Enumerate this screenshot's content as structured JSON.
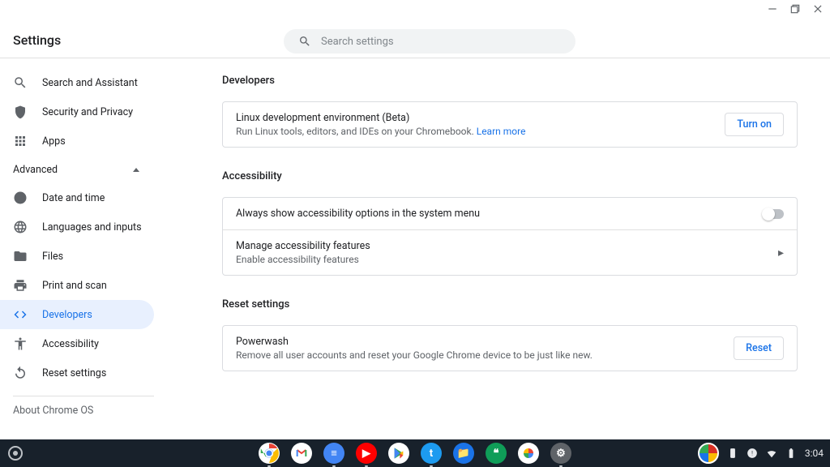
{
  "window": {
    "title": "Settings"
  },
  "search": {
    "placeholder": "Search settings"
  },
  "sidebar": {
    "top": [
      {
        "id": "search-assistant",
        "label": "Search and Assistant"
      },
      {
        "id": "security-privacy",
        "label": "Security and Privacy"
      },
      {
        "id": "apps",
        "label": "Apps"
      }
    ],
    "advanced_label": "Advanced",
    "adv": [
      {
        "id": "date-time",
        "label": "Date and time"
      },
      {
        "id": "languages",
        "label": "Languages and inputs"
      },
      {
        "id": "files",
        "label": "Files"
      },
      {
        "id": "print-scan",
        "label": "Print and scan"
      },
      {
        "id": "developers",
        "label": "Developers",
        "active": true
      },
      {
        "id": "accessibility",
        "label": "Accessibility"
      },
      {
        "id": "reset",
        "label": "Reset settings"
      }
    ],
    "about": "About Chrome OS"
  },
  "main": {
    "developers": {
      "heading": "Developers",
      "linux_title": "Linux development environment (Beta)",
      "linux_desc": "Run Linux tools, editors, and IDEs on your Chromebook. ",
      "linux_learn": "Learn more",
      "turn_on": "Turn on"
    },
    "accessibility": {
      "heading": "Accessibility",
      "always_show": "Always show accessibility options in the system menu",
      "manage_title": "Manage accessibility features",
      "manage_desc": "Enable accessibility features"
    },
    "reset": {
      "heading": "Reset settings",
      "powerwash_title": "Powerwash",
      "powerwash_desc": "Remove all user accounts and reset your Google Chrome device to be just like new.",
      "reset_btn": "Reset"
    }
  },
  "shelf": {
    "apps": [
      {
        "id": "chrome",
        "bg": "#fff",
        "letter": "",
        "running": true
      },
      {
        "id": "gmail",
        "bg": "#fff",
        "letter": "M"
      },
      {
        "id": "docs",
        "bg": "#4285f4",
        "letter": "≡",
        "running": true
      },
      {
        "id": "youtube",
        "bg": "#ff0000",
        "letter": "▶",
        "running": true
      },
      {
        "id": "play",
        "bg": "#fff",
        "letter": "▶"
      },
      {
        "id": "twitter",
        "bg": "#1d9bf0",
        "letter": "t",
        "running": true
      },
      {
        "id": "files",
        "bg": "#1a73e8",
        "letter": "📁"
      },
      {
        "id": "hangouts",
        "bg": "#0f9d58",
        "letter": "❝"
      },
      {
        "id": "photos",
        "bg": "#fff",
        "letter": "✦"
      },
      {
        "id": "settings",
        "bg": "#5f6368",
        "letter": "⚙",
        "running": true
      }
    ],
    "clock": "3:04"
  }
}
